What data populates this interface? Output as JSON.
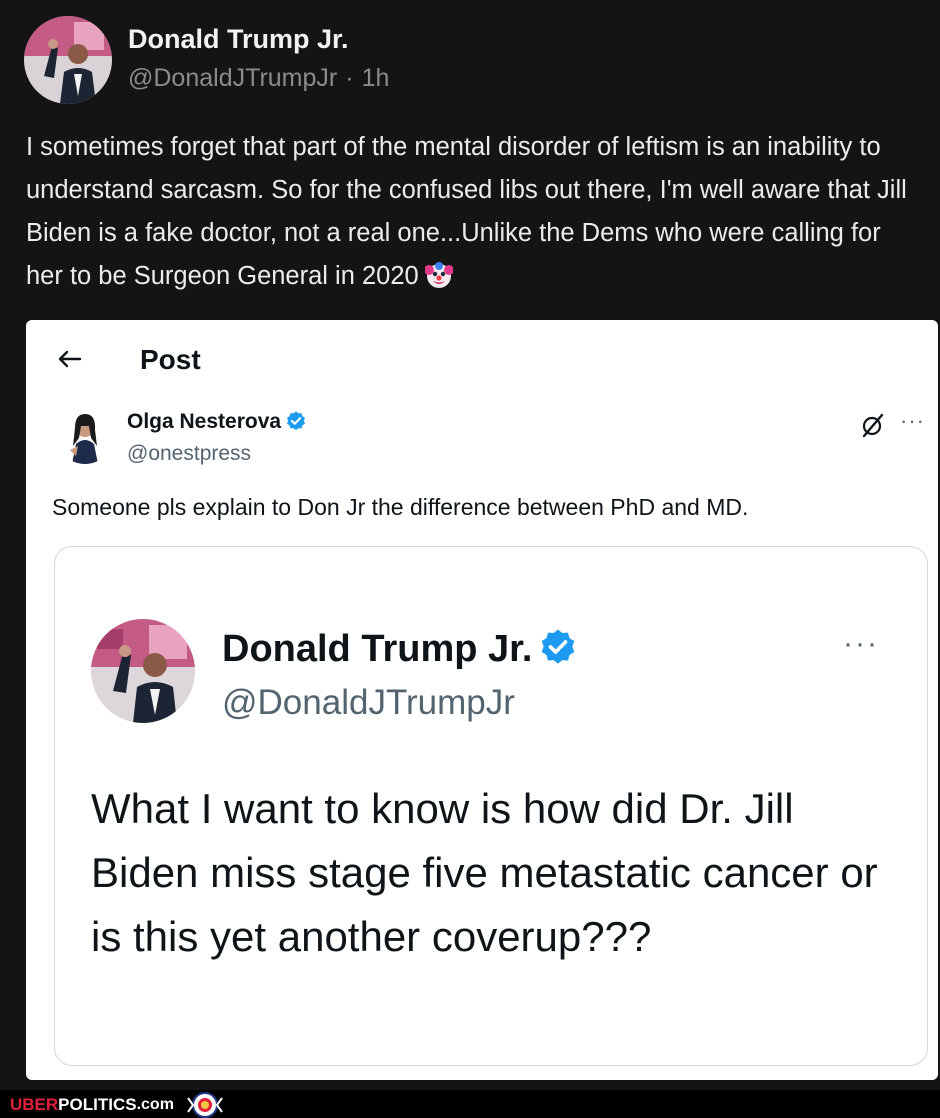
{
  "outer_post": {
    "author_name": "Donald Trump Jr.",
    "handle": "@DonaldJTrumpJr",
    "separator": "·",
    "time": "1h",
    "text": "I sometimes forget that part of the mental disorder of leftism is an inability to understand sarcasm. So for the confused libs out there, I'm well aware that Jill Biden is a fake doctor, not a real one...Unlike the Dems who were calling for her to be Surgeon General in 2020",
    "emoji_icon": "clown-face-icon",
    "avatar_icon": "profile-photo"
  },
  "screenshot": {
    "header": {
      "back_icon": "back-arrow-icon",
      "title": "Post"
    },
    "post": {
      "author_name": "Olga Nesterova",
      "verified_icon": "verified-badge-icon",
      "handle": "@onestpress",
      "grok_icon": "grok-icon",
      "more_label": "···",
      "text": "Someone pls explain to Don Jr the difference between PhD and MD."
    },
    "quoted_post": {
      "author_name": "Donald Trump Jr.",
      "verified_icon": "verified-badge-icon",
      "handle": "@DonaldJTrumpJr",
      "more_label": "···",
      "text": "What I want to know is how did Dr. Jill Biden miss stage five metastatic cancer or is this yet another coverup???"
    }
  },
  "watermark": {
    "part1": "UBER",
    "part2": "POLITICS",
    "part3": ".com",
    "logo_icon": "lion-crest-logo"
  },
  "colors": {
    "background": "#000000",
    "post_background": "#141414",
    "verified_blue": "#1d9bf0",
    "watermark_red": "#e0203b"
  }
}
